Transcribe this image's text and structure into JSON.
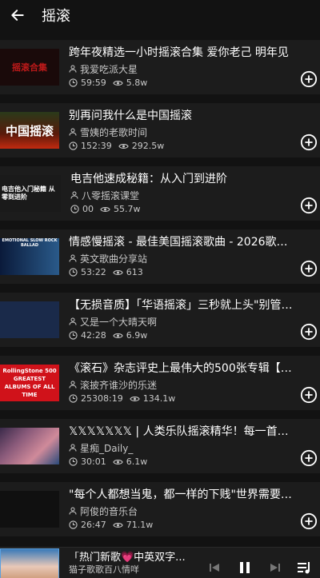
{
  "header": {
    "title": "摇滚",
    "back_icon": "arrow-left-icon"
  },
  "videos": [
    {
      "title": "跨年夜精选一小时摇滚合集 爱你老己 明年见",
      "author": "我爱吃派大星",
      "duration": "59:59",
      "views": "5.8w",
      "thumb_text": "摇滚合集"
    },
    {
      "title": "别再问我什么是中国摇滚",
      "author": "雪姨的老歌时间",
      "duration": "152:39",
      "views": "292.5w",
      "thumb_text": "中国摇滚"
    },
    {
      "title": "电吉他速成秘籍：从入门到进阶",
      "author": "八零摇滚课堂",
      "duration": "00",
      "views": "55.7w",
      "thumb_text": "电吉他入门秘籍 从零到进阶"
    },
    {
      "title": "情感慢摇滚 - 最佳美国摇滚歌曲 - 2026歌单🎸 -Not...",
      "author": "英文歌曲分享站",
      "duration": "53:22",
      "views": "613",
      "thumb_text": "EMOTIONAL SLOW ROCK BALLAD"
    },
    {
      "title": "【无损音质】「华语摇滚」三秒就上头\"别管明天...",
      "author": "又是一个大晴天啊",
      "duration": "42:28",
      "views": "6.9w",
      "thumb_text": ""
    },
    {
      "title": "《滚石》杂志评史上最伟大的500张专辑【全集整...",
      "author": "滚披齐谁沙的乐迷",
      "duration": "25308:19",
      "views": "134.1w",
      "thumb_text": "RollingStone 500 GREATEST ALBUMS OF ALL TIME"
    },
    {
      "title": "𝕏𝕏𝕏𝕏𝕏𝕏𝕏 | 人类乐队摇滚精华！每一首都是极品！...",
      "author": "星痴_Daily_",
      "duration": "30:01",
      "views": "6.1w",
      "thumb_text": ""
    },
    {
      "title": "\"每个人都想当鬼，都一样的下贱\"世界需要摇滚，...",
      "author": "阿俊的音乐台",
      "duration": "26:47",
      "views": "71.1w",
      "thumb_text": ""
    }
  ],
  "player": {
    "title": "「热门新歌💗中英双字...",
    "author": "猫子歌歌百八情咩"
  }
}
